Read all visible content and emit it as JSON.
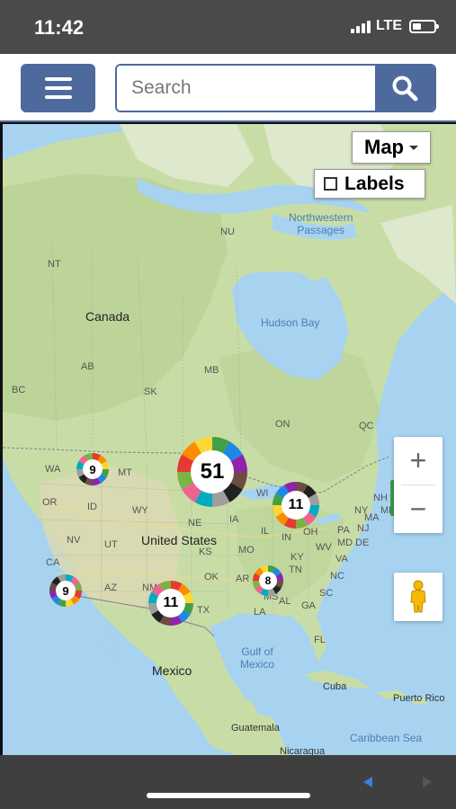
{
  "status": {
    "time": "11:42",
    "network": "LTE",
    "battery_level": 0.4
  },
  "header": {
    "menu_icon": "hamburger-icon",
    "search_placeholder": "Search",
    "search_icon": "search-icon"
  },
  "map": {
    "type_selector": {
      "label": "Map",
      "icon": "caret-down-icon"
    },
    "labels_toggle": {
      "label": "Labels",
      "checked": false
    },
    "zoom": {
      "in_label": "+",
      "out_label": "−"
    },
    "pegman_icon": "pegman-icon",
    "countries": {
      "canada": "Canada",
      "us": "United States",
      "mexico": "Mexico"
    },
    "water": {
      "hudson_bay": "Hudson Bay",
      "gulf_line1": "Gulf of",
      "gulf_line2": "Mexico",
      "nw_line1": "Northwestern",
      "nw_line2": "Passages",
      "caribbean": "Caribbean Sea"
    },
    "places": {
      "cuba": "Cuba",
      "puerto_rico": "Puerto Rico",
      "guatemala": "Guatemala",
      "nicaragua": "Nicaragua"
    },
    "regions": {
      "nt": "NT",
      "nu": "NU",
      "bc": "BC",
      "ab": "AB",
      "sk": "SK",
      "mb": "MB",
      "on": "ON",
      "qc": "QC",
      "wa": "WA",
      "mt": "MT",
      "or": "OR",
      "id": "ID",
      "wy": "WY",
      "ne": "NE",
      "ia": "IA",
      "wi": "WI",
      "nv": "NV",
      "ut": "UT",
      "ks": "KS",
      "ca": "CA",
      "az": "AZ",
      "nm": "NM",
      "ok": "OK",
      "ar": "AR",
      "tx": "TX",
      "la": "LA",
      "ms": "MS",
      "al": "AL",
      "ga": "GA",
      "fl": "FL",
      "sc": "SC",
      "nc": "NC",
      "tn": "TN",
      "ky": "KY",
      "oh": "OH",
      "in": "IN",
      "il": "IL",
      "mo": "MO",
      "wv": "WV",
      "va": "VA",
      "pa": "PA",
      "md": "MD",
      "de": "DE",
      "nj": "NJ",
      "ny": "NY",
      "nh": "NH",
      "ma": "MA",
      "me": "ME",
      "mi": "MI"
    },
    "clusters": [
      {
        "id": "pacific-nw",
        "count": "9"
      },
      {
        "id": "central",
        "count": "51"
      },
      {
        "id": "great-lakes",
        "count": "11"
      },
      {
        "id": "california",
        "count": "9"
      },
      {
        "id": "southwest",
        "count": "11"
      },
      {
        "id": "south",
        "count": "8"
      }
    ]
  },
  "nav": {
    "back_icon": "back-arrow-icon",
    "forward_icon": "forward-arrow-icon"
  }
}
